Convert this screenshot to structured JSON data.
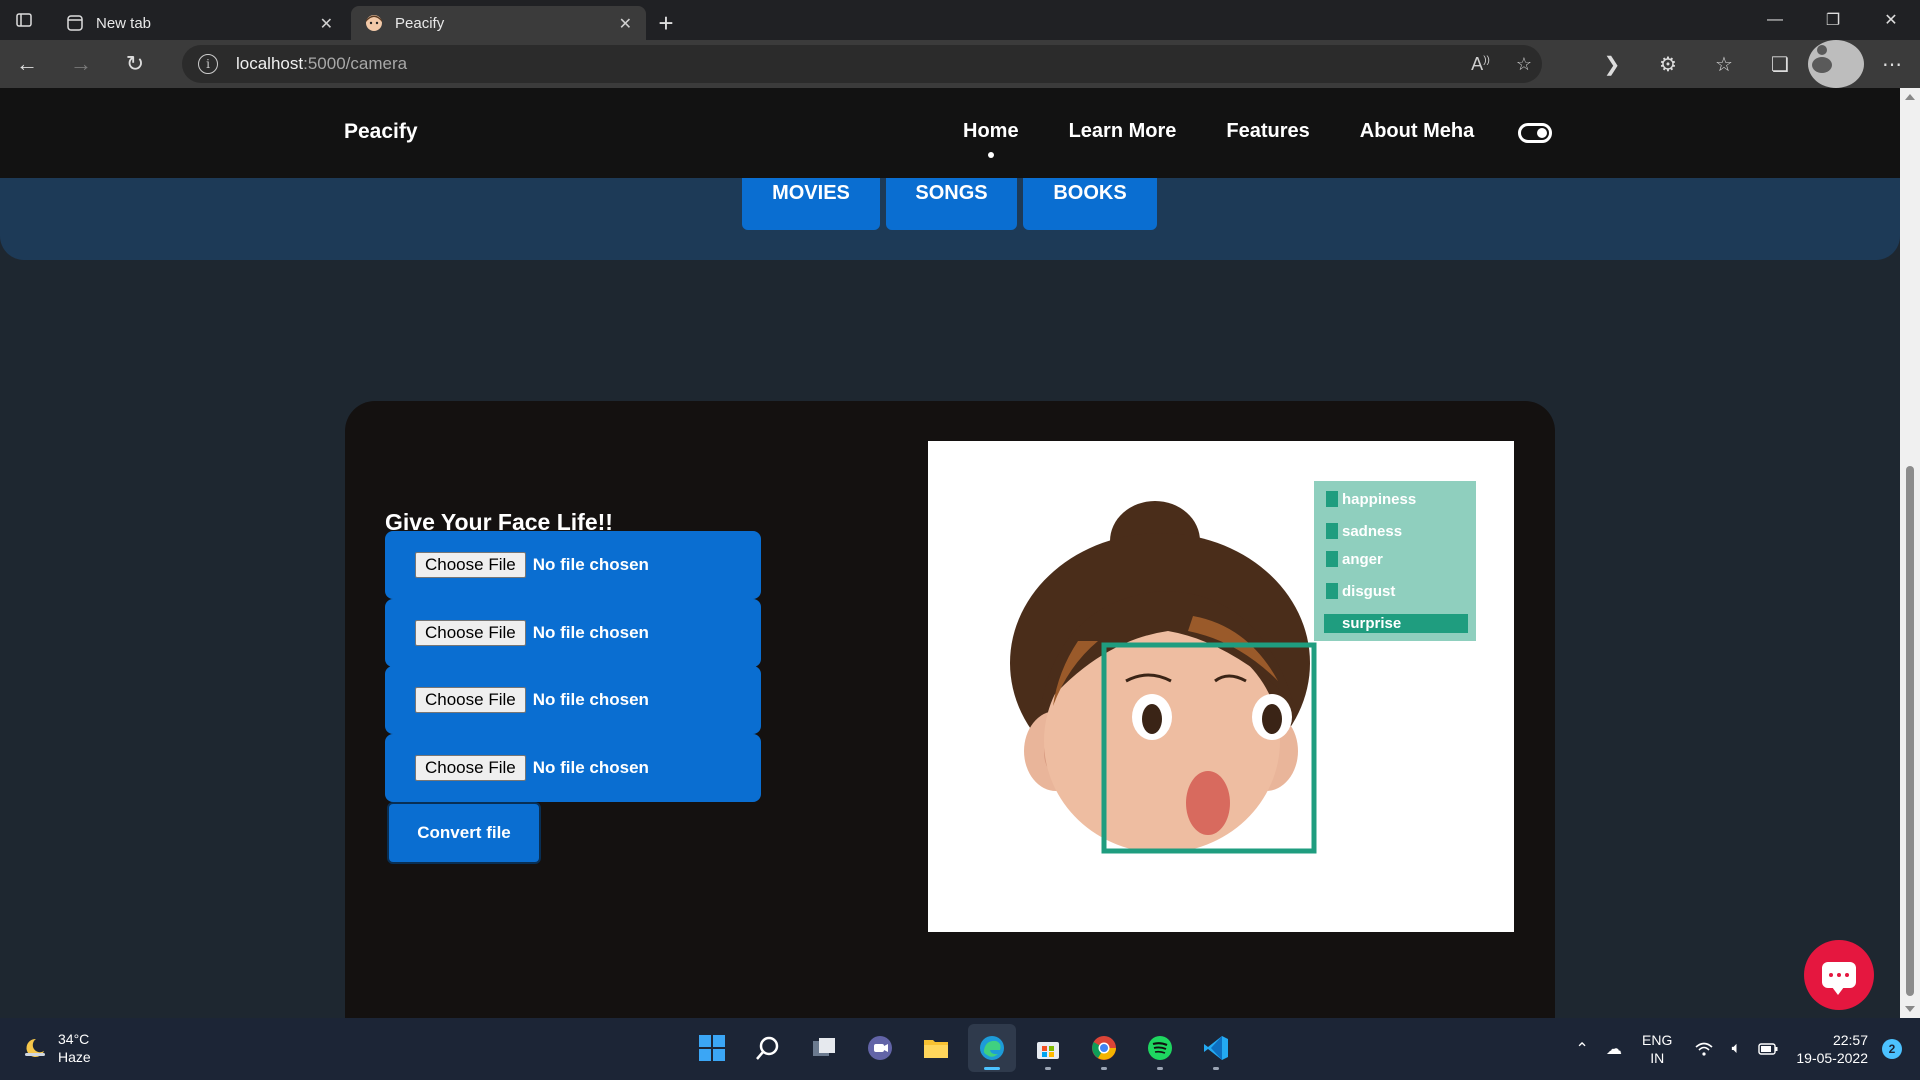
{
  "browser": {
    "tabs": [
      {
        "label": "New tab",
        "active": false,
        "icon": "new-tab-page-icon"
      },
      {
        "label": "Peacify",
        "active": true,
        "icon": "peacify-favicon"
      }
    ],
    "url_host": "localhost",
    "url_path": ":5000/camera"
  },
  "nav": {
    "brand": "Peacify",
    "links": [
      "Home",
      "Learn More",
      "Features",
      "About Meha"
    ],
    "active": "Home"
  },
  "categories": [
    "MOVIES",
    "SONGS",
    "BOOKS"
  ],
  "upload": {
    "title": "Give Your Face Life!!",
    "choose_label": "Choose File",
    "file_status": "No file chosen",
    "convert_label": "Convert file"
  },
  "emotion_image": {
    "labels": [
      "happiness",
      "sadness",
      "anger",
      "disgust",
      "surprise"
    ],
    "highlighted": "surprise"
  },
  "taskbar": {
    "weather_temp": "34°C",
    "weather_desc": "Haze",
    "lang_top": "ENG",
    "lang_bottom": "IN",
    "time": "22:57",
    "date": "19-05-2022",
    "notifications": "2"
  },
  "colors": {
    "accent_blue": "#0a6ed1",
    "nav_bg": "#121212",
    "card_bg": "#141110",
    "chat_red": "#e5173f",
    "emotion_panel": "#8fcfbe",
    "face_box": "#1f9d7f"
  }
}
